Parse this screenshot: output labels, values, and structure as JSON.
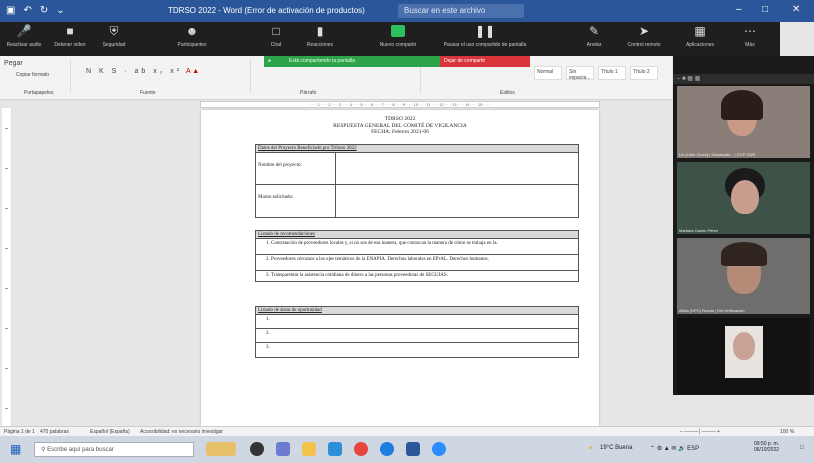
{
  "window": {
    "title": "TDRSO 2022 - Word (Error de activación de productos)",
    "search_placeholder": "Buscar en este archivo"
  },
  "zoom_toolbar": {
    "items": [
      "Reactivar audio",
      "Detener video",
      "Seguridad",
      "Participantes",
      "Chat",
      "Reacciones",
      "Nuevo compartir",
      "Pausar el uso compartido de pantalla",
      "Anotar",
      "Control remoto",
      "Aplicaciones",
      "Más"
    ],
    "recording": "Está compartiendo la pantalla",
    "stop_share": "Dejar de compartir"
  },
  "ribbon": {
    "paste_label": "Pegar",
    "format_painter": "Copiar formato",
    "groups": [
      "Portapapeles",
      "Fuente",
      "Párrafo",
      "Estilos"
    ],
    "styles": [
      "Normal",
      "Sin espacia...",
      "Título 1",
      "Título 2"
    ],
    "find": "Buscar",
    "replace": "Reemplazar",
    "select": "Seleccionar"
  },
  "document": {
    "header": [
      "TDRSO 2022",
      "RESPUESTA GENERAL DEL COMITÉ DE VIGILANCIA",
      "FECHA: Febrero 2021-06"
    ],
    "table1": {
      "title": "Datos del Proyecto Beneficiado por Tributo 2022",
      "rows": [
        {
          "label": "Nombre del proyecto:",
          "value": ""
        },
        {
          "label": "Monto solicitado:",
          "value": ""
        }
      ]
    },
    "table2": {
      "title": "Listado de recomendaciones",
      "items": [
        "1. Contratación de proveedores locales y, si no sea de esa manera, que conozcan la manera de cómo se trabaja en la.",
        "2. Proveedores cercanos a los ejes temáticos de la ENAPIA. Derechos laborales en EPrAL. Derechos humanos.",
        "3. Transparentar la asistencia cotidiana de dinero a las personas proveedoras de SEGUIAS."
      ]
    },
    "table3": {
      "title": "Listado de áreas de oportunidad",
      "items": [
        "1.",
        "2.",
        "3."
      ]
    }
  },
  "participants": [
    {
      "name": "Liz (Lider Zoom) | Sustainabl... | OCP 2025"
    },
    {
      "name": "Mariana Castro Pérez"
    },
    {
      "name": "Alicia (OPC) Rueda | Sin Verificación"
    },
    {
      "name": ""
    }
  ],
  "statusbar": {
    "page": "Página 1 de 1",
    "words": "470 palabras",
    "lang": "Español (España)",
    "accessibility": "Accesibilidad: es necesario investigar",
    "zoom": "100 %"
  },
  "taskbar": {
    "search_placeholder": "Escribe aquí para buscar",
    "weather": "19°C Buena",
    "time": "09:50 p. m.",
    "date": "06/10/2022"
  }
}
